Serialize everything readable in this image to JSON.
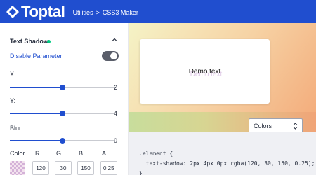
{
  "header": {
    "brand": "Toptal",
    "breadcrumbs": [
      "Utilities",
      "CSS3 Maker"
    ],
    "separator": ">"
  },
  "panel": {
    "title": "Text Shadow",
    "disable_label": "Disable Parameter",
    "toggle_on": true,
    "sliders": [
      {
        "label": "X:",
        "value": "2",
        "fraction": 0.5
      },
      {
        "label": "Y:",
        "value": "4",
        "fraction": 0.5
      },
      {
        "label": "Blur:",
        "value": "0",
        "fraction": 0.5
      }
    ],
    "color": {
      "label": "Color",
      "channels": [
        {
          "label": "R",
          "value": "120"
        },
        {
          "label": "G",
          "value": "30"
        },
        {
          "label": "B",
          "value": "150"
        },
        {
          "label": "A",
          "value": "0.25"
        }
      ]
    }
  },
  "preview": {
    "demo_text": "Demo text",
    "select_value": "Colors"
  },
  "code": {
    "lines": [
      ".element {",
      "  text-shadow: 2px 4px 0px rgba(120, 30, 150, 0.25);",
      "}"
    ]
  },
  "colors": {
    "brand": "#204ecf",
    "accent_dot": "#00cc83"
  }
}
